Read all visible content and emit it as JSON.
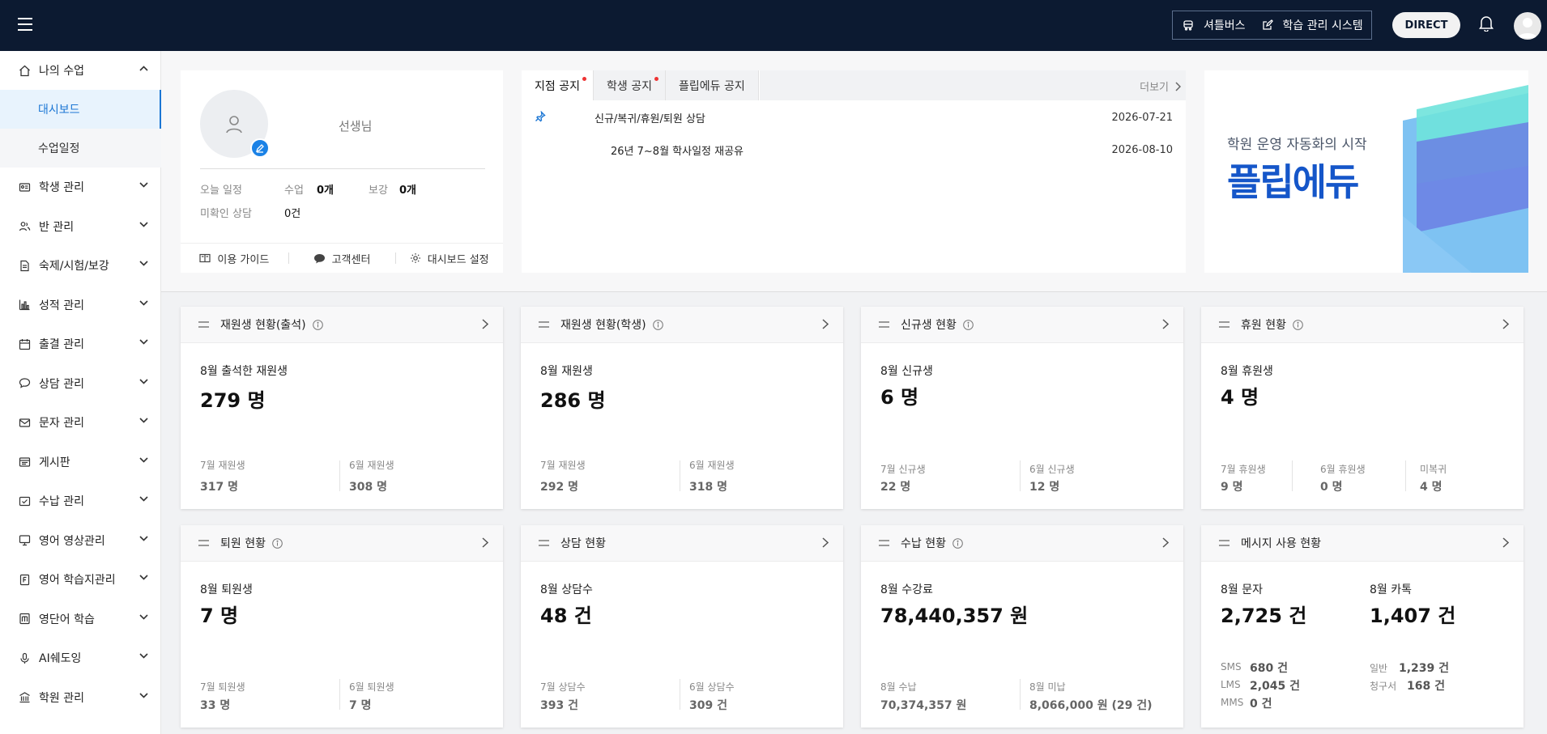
{
  "topbar": {
    "shuttle_label": "셔틀버스",
    "lms_label": "학습 관리 시스템",
    "direct_label": "DIRECT"
  },
  "sidebar": {
    "my_class": "나의 수업",
    "dashboard": "대시보드",
    "schedule": "수업일정",
    "items": [
      {
        "label": "학생 관리",
        "icon": "id-card-icon"
      },
      {
        "label": "반 관리",
        "icon": "group-icon"
      },
      {
        "label": "숙제/시험/보강",
        "icon": "document-icon"
      },
      {
        "label": "성적 관리",
        "icon": "bar-chart-icon"
      },
      {
        "label": "출결 관리",
        "icon": "calendar-icon"
      },
      {
        "label": "상담 관리",
        "icon": "chat-icon"
      },
      {
        "label": "문자 관리",
        "icon": "mail-icon"
      },
      {
        "label": "게시판",
        "icon": "board-icon"
      },
      {
        "label": "수납 관리",
        "icon": "payment-icon"
      },
      {
        "label": "영어 영상관리",
        "icon": "monitor-icon"
      },
      {
        "label": "영어 학습지관리",
        "icon": "book-icon"
      },
      {
        "label": "영단어 학습",
        "icon": "word-icon"
      },
      {
        "label": "AI쉐도잉",
        "icon": "mic-icon"
      },
      {
        "label": "학원 관리",
        "icon": "building-icon"
      }
    ]
  },
  "profile": {
    "name": "선생님",
    "today_label": "오늘 일정",
    "class_label": "수업",
    "class_value": "0개",
    "makeup_label": "보강",
    "makeup_value": "0개",
    "unconfirmed_label": "미확인 상담",
    "unconfirmed_value": "0건",
    "guide_label": "이용 가이드",
    "support_label": "고객센터",
    "settings_label": "대시보드 설정"
  },
  "notice": {
    "tabs": [
      "지점 공지",
      "학생 공지",
      "플립에듀 공지"
    ],
    "more_label": "더보기",
    "rows": [
      {
        "title": "신규/복귀/휴원/퇴원 상담",
        "date": "2026-07-21"
      },
      {
        "title": "26년 7~8월 학사일정 재공유",
        "date": "2026-08-10"
      }
    ]
  },
  "banner": {
    "subtitle": "학원 운영 자동화의 시작",
    "logo": "플립에듀"
  },
  "cards": {
    "att": {
      "title": "재원생 현황(출석)",
      "label": "8월 출석한 재원생",
      "value": "279 명",
      "s1_label": "7월 재원생",
      "s1_value": "317 명",
      "s2_label": "6월 재원생",
      "s2_value": "308 명"
    },
    "stu": {
      "title": "재원생 현황(학생)",
      "label": "8월 재원생",
      "value": "286 명",
      "s1_label": "7월 재원생",
      "s1_value": "292 명",
      "s2_label": "6월 재원생",
      "s2_value": "318 명"
    },
    "new": {
      "title": "신규생 현황",
      "label": "8월 신규생",
      "value": "6 명",
      "s1_label": "7월 신규생",
      "s1_value": "22 명",
      "s2_label": "6월 신규생",
      "s2_value": "12 명"
    },
    "leave": {
      "title": "휴원 현황",
      "label": "8월 휴원생",
      "value": "4 명",
      "s1_label": "7월 휴원생",
      "s1_value": "9 명",
      "s2_label": "6월 휴원생",
      "s2_value": "0 명",
      "s3_label": "미복귀",
      "s3_value": "4 명"
    },
    "quit": {
      "title": "퇴원 현황",
      "label": "8월 퇴원생",
      "value": "7 명",
      "s1_label": "7월 퇴원생",
      "s1_value": "33 명",
      "s2_label": "6월 퇴원생",
      "s2_value": "7 명"
    },
    "consult": {
      "title": "상담 현황",
      "label": "8월 상담수",
      "value": "48 건",
      "s1_label": "7월 상담수",
      "s1_value": "393 건",
      "s2_label": "6월 상담수",
      "s2_value": "309 건"
    },
    "pay": {
      "title": "수납 현황",
      "label": "8월 수강료",
      "value": "78,440,357 원",
      "s1_label": "8월 수납",
      "s1_value": "70,374,357 원",
      "s2_label": "8월 미납",
      "s2_value": "8,066,000 원 (29 건)"
    },
    "msg": {
      "title": "메시지 사용 현황",
      "label": "8월 문자",
      "value": "2,725 건",
      "label2": "8월 카톡",
      "value2": "1,407 건",
      "sms_label": "SMS",
      "sms_value": "680 건",
      "lms_label": "LMS",
      "lms_value": "2,045 건",
      "mms_label": "MMS",
      "mms_value": "0 건",
      "normal_label": "일반",
      "normal_value": "1,239 건",
      "bill_label": "청구서",
      "bill_value": "168 건"
    }
  },
  "colors": {
    "topbar": "#0c1a31",
    "accent": "#1b76d4",
    "notice_dot": "#ee3333"
  }
}
